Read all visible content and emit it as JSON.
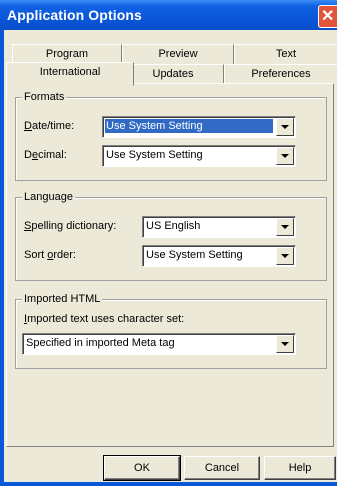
{
  "window": {
    "title": "Application Options",
    "close_glyph": "✕"
  },
  "tabs": {
    "row1": [
      "Program",
      "Preview",
      "Text"
    ],
    "row2": [
      "International",
      "Updates",
      "Preferences"
    ],
    "active": "International"
  },
  "formats": {
    "title": "Formats",
    "date_label_u": "D",
    "date_label_rest": "ate/time:",
    "date_value": "Use System Setting",
    "decimal_label_a": "D",
    "decimal_label_u": "e",
    "decimal_label_rest": "cimal:",
    "decimal_value": "Use System Setting"
  },
  "language": {
    "title": "Language",
    "spelling_label_u": "S",
    "spelling_label_rest": "pelling dictionary:",
    "spelling_value": "US English",
    "sort_label_a": "Sort ",
    "sort_label_u": "o",
    "sort_label_rest": "rder:",
    "sort_value": "Use System Setting"
  },
  "imported": {
    "title": "Imported HTML",
    "charset_label_u": "I",
    "charset_label_rest": "mported text uses character set:",
    "charset_value": "Specified in imported Meta tag"
  },
  "buttons": {
    "ok": "OK",
    "cancel": "Cancel",
    "help": "Help"
  },
  "colors": {
    "titlebar": "#0a58d8",
    "selection": "#316ac5",
    "face": "#ece9d8",
    "close": "#e2553a"
  }
}
